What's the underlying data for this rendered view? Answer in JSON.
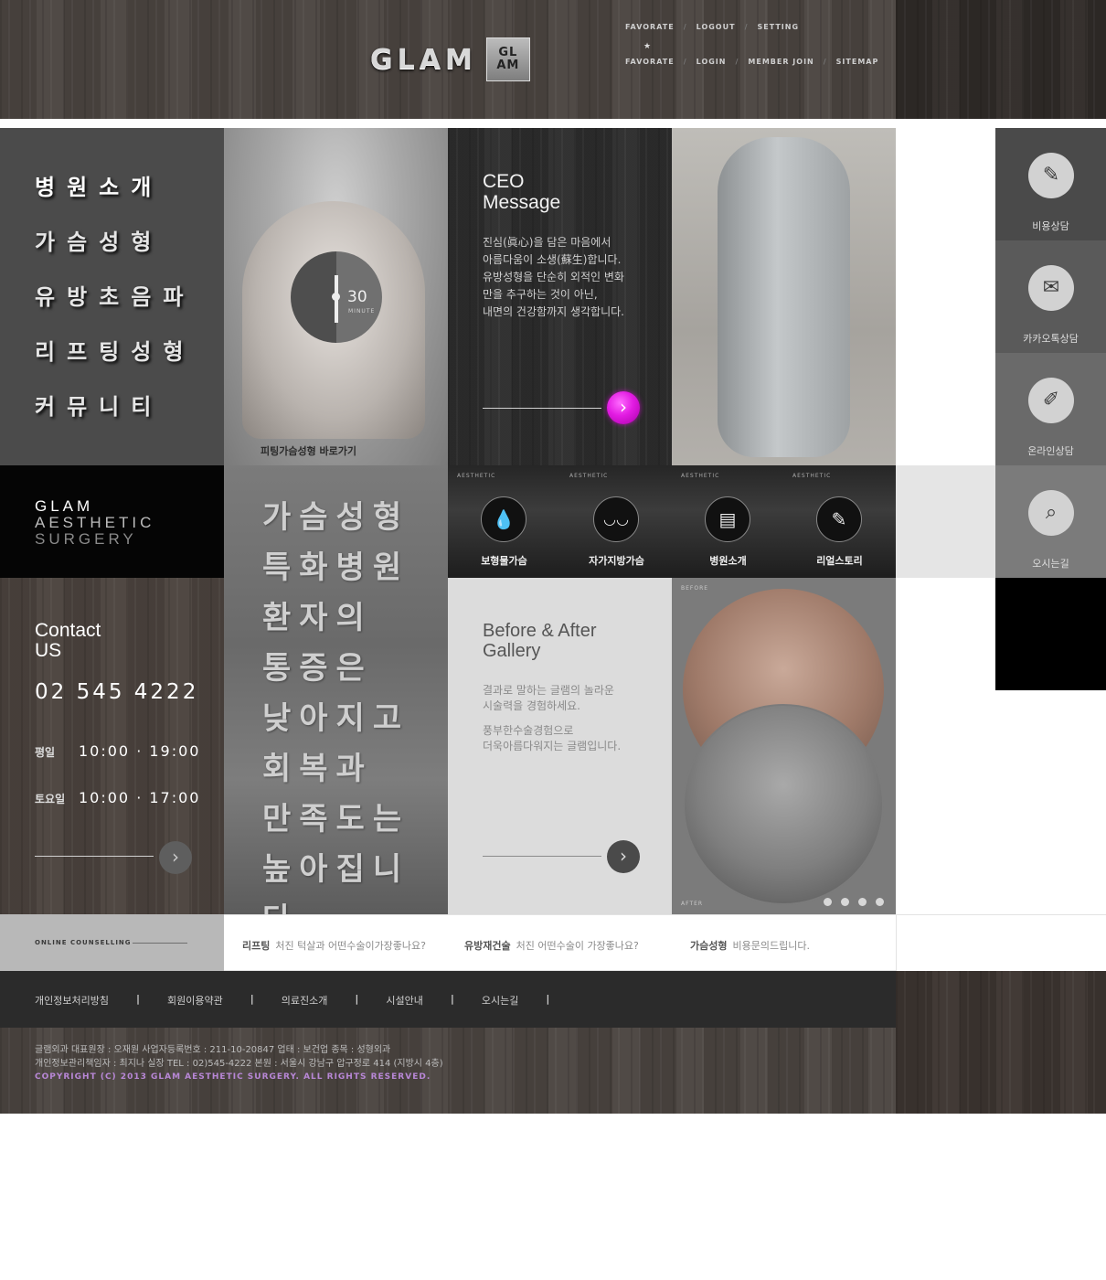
{
  "header": {
    "logo_text": "GLAM",
    "logo_badge": "GL AM",
    "top_row": [
      "FAVORATE",
      "LOGOUT",
      "SETTING"
    ],
    "bottom_row": [
      "FAVORATE",
      "LOGIN",
      "MEMBER JOIN",
      "SITEMAP"
    ],
    "star": "★",
    "separator": "/"
  },
  "menu": {
    "items": [
      "병원소개",
      "가슴성형",
      "유방초음파",
      "리프팅성형",
      "커뮤니티"
    ]
  },
  "promo": {
    "timer_value": "30",
    "timer_unit": "MINUTE",
    "caption": "피팅가슴성형 바로가기"
  },
  "ceo": {
    "title_line1": "CEO",
    "title_line2": "Message",
    "text": [
      "진심(眞心)을 담은 마음에서",
      "아름다움이 소생(蘇生)합니다.",
      "유방성형을 단순히 외적인 변화",
      "만을 추구하는 것이 아닌,",
      "내면의 건강함까지 생각합니다."
    ],
    "button_icon": "›"
  },
  "sidebar": {
    "items": [
      {
        "label": "비용상담",
        "icon": "tag-icon",
        "glyph": "✎",
        "bg": "#4a4a4a"
      },
      {
        "label": "카카오톡상담",
        "icon": "chat-icon",
        "glyph": "✉",
        "bg": "#5a5a5a"
      },
      {
        "label": "온라인상담",
        "icon": "pencil-icon",
        "glyph": "✐",
        "bg": "#6a6a6a"
      },
      {
        "label": "오시는길",
        "icon": "search-icon",
        "glyph": "⌕",
        "bg": "#7b7b7b"
      }
    ]
  },
  "brand": {
    "line1": "GLAM",
    "line2": "AESTHETIC",
    "line3": "SURGERY"
  },
  "slogan": {
    "lines": [
      "가슴성형",
      "특화병원",
      "환자의",
      "통증은",
      "낮아지고",
      "회복과",
      "만족도는",
      "높아집니다."
    ]
  },
  "tiles": [
    {
      "tag": "AESTHETIC",
      "label": "보형물가슴",
      "icon": "drop-icon",
      "glyph": "💧"
    },
    {
      "tag": "AESTHETIC",
      "label": "자가지방가슴",
      "icon": "breast-icon",
      "glyph": "◡◡"
    },
    {
      "tag": "AESTHETIC",
      "label": "병원소개",
      "icon": "building-icon",
      "glyph": "▤"
    },
    {
      "tag": "AESTHETIC",
      "label": "리얼스토리",
      "icon": "tag-icon",
      "glyph": "✎"
    }
  ],
  "contact": {
    "title_line1": "Contact",
    "title_line2": "US",
    "phone": "02 545 4222",
    "weekday_label": "평일",
    "weekday_hours": "10:00 · 19:00",
    "saturday_label": "토요일",
    "saturday_hours": "10:00 · 17:00",
    "button_icon": "›"
  },
  "gallery": {
    "title_line1": "Before & After",
    "title_line2": "Gallery",
    "text1": [
      "결과로 말하는 글램의 놀라운",
      "시술력을 경험하세요."
    ],
    "text2": [
      "풍부한수술경험으로",
      "더욱아름다워지는 글램입니다."
    ],
    "button_icon": "›",
    "before_label": "BEFORE",
    "after_label": "AFTER",
    "dot_count": 4
  },
  "counselling": {
    "title": "ONLINE COUNSELLING",
    "faqs": [
      {
        "category": "리프팅",
        "question": "처진 턱살과 어떤수술이가장좋나요?"
      },
      {
        "category": "유방재건술",
        "question": "처진 어떤수술이 가장좋나요?"
      },
      {
        "category": "가슴성형",
        "question": "비용문의드립니다."
      }
    ]
  },
  "footer": {
    "links": [
      "개인정보처리방침",
      "회원이용약관",
      "의료진소개",
      "시설안내",
      "오시는길"
    ],
    "link_sep": "|",
    "info_line1": "글램외과 대표원장 : 오재원    사업자등록번호 : 211-10-20847    업태 : 보건업    종목 : 성형외과",
    "info_line2": "개인정보관리책임자 : 최지나 실장    TEL : 02)545-4222    본원 : 서울시 강남구 압구정로 414 (지방시 4층)",
    "copyright": "COPYRIGHT (C) 2013 GLAM AESTHETIC SURGERY. ALL RIGHTS RESERVED."
  }
}
